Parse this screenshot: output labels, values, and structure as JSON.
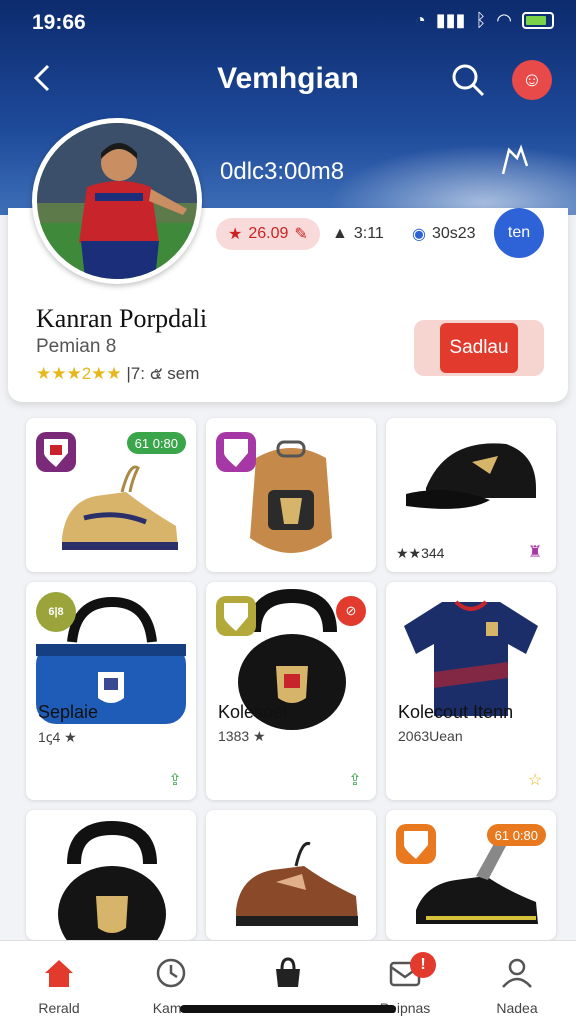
{
  "status_bar": {
    "time": "19:66"
  },
  "header": {
    "title": "Vemhgian",
    "banner_text": "0dlc3:00m8"
  },
  "profile": {
    "name": "Kanran Porpdali",
    "role": "Pemian 8",
    "rating_stars": "★★★2★★",
    "rating_text": "|7: ๕ sem",
    "stat_badge": "26.09",
    "stat_time": "3:11",
    "stat_count": "30s23",
    "follow_label": "ten",
    "action_label": "Sadlau"
  },
  "products": [
    {
      "tag": "61 0:80",
      "tag_color": "#3aa54a",
      "badge_color": "#7b2a7a",
      "label": "",
      "meta": ""
    },
    {
      "tag": "",
      "badge_color": "#a638a6",
      "label": "",
      "meta": ""
    },
    {
      "tag": "",
      "badge_color": "",
      "label": "",
      "meta": "★★344"
    },
    {
      "tag": "",
      "badge_color": "#9aa43a",
      "badge_text": "6|8",
      "label": "Seplaie",
      "meta": "1ꞔ4 ★"
    },
    {
      "tag": "",
      "badge_color": "#b3a83a",
      "label": "Kolesoei",
      "meta": "1383 ★"
    },
    {
      "tag": "",
      "badge_color": "",
      "label": "Kolecout Itenn",
      "meta": "2063Uean"
    },
    {
      "tag": "",
      "badge_color": "",
      "label": "",
      "meta": ""
    },
    {
      "tag": "",
      "badge_color": "",
      "label": "",
      "meta": ""
    },
    {
      "tag": "61 0:80",
      "tag_color": "#e8791e",
      "badge_color": "#e8791e",
      "label": "",
      "meta": ""
    }
  ],
  "tabs": [
    {
      "label": "Rerald"
    },
    {
      "label": "Kama"
    },
    {
      "label": ""
    },
    {
      "label": "Peipnas"
    },
    {
      "label": "Nadea"
    }
  ],
  "colors": {
    "accent": "#e33a2e",
    "header": "#1e4a9a",
    "primary_blue": "#2d63d6"
  }
}
